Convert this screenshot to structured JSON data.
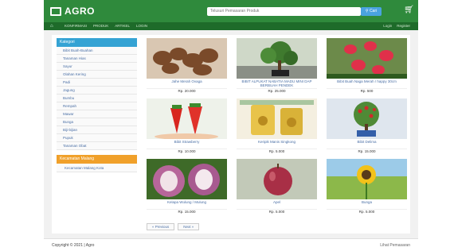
{
  "header": {
    "logo_text": "AGRO",
    "search_placeholder": "Telusuri Pemasaran Produk",
    "search_button": "Cari",
    "cart_icon": "cart-icon",
    "brand_color": "#2f8a3c",
    "accent_color": "#35a3d4"
  },
  "nav": {
    "items": [
      "KONFIRMASI",
      "PRODUK",
      "ARTIKEL",
      "LOGIN"
    ],
    "right": [
      "Login",
      "Register"
    ]
  },
  "sidebar": {
    "heading": "Kategori",
    "items": [
      "Bibit Buah-Buahan",
      "Tanaman Hias",
      "Sayur",
      "Olahan Kering",
      "Padi",
      "Jagung",
      "Bumbu",
      "Rempah",
      "Mawar",
      "Bunga",
      "Biji-bijian",
      "Pupuk",
      "Tanaman Obat"
    ],
    "heading2": "Kecamatan Malang",
    "sub_items": [
      "Kecamatan Malang Kota"
    ]
  },
  "products": [
    {
      "name": "Jahe Merah Ovaga",
      "price": "Rp. 20.000",
      "img": "ginger"
    },
    {
      "name": "BIBIT ALPUKAT NABATIA MADU MINI DAP BERBUAH PENDEK",
      "price": "Rp. 25.000",
      "img": "bonsai"
    },
    {
      "name": "Bibit Buah Naga Merah / happy 30cm",
      "price": "Rp. 500",
      "img": "dragonfruit"
    },
    {
      "name": "Bibit Strawberry",
      "price": "Rp. 10.000",
      "img": "strawberry"
    },
    {
      "name": "Keripik Manis Singkong",
      "price": "Rp. 5.000",
      "img": "chips"
    },
    {
      "name": "Bibit Delima",
      "price": "Rp. 15.000",
      "img": "pomegranate"
    },
    {
      "name": "Kelapa Wulung / Mulung",
      "price": "Rp. 15.000",
      "img": "coconut"
    },
    {
      "name": "Apel",
      "price": "Rp. 5.000",
      "img": "apple"
    },
    {
      "name": "Bunga",
      "price": "Rp. 5.000",
      "img": "sunflower"
    }
  ],
  "pager": {
    "prev": "« Previous",
    "next": "Next »"
  },
  "footer": {
    "left": "Copyright © 2021 | Agro",
    "right": "Lihat Pemasaran"
  }
}
